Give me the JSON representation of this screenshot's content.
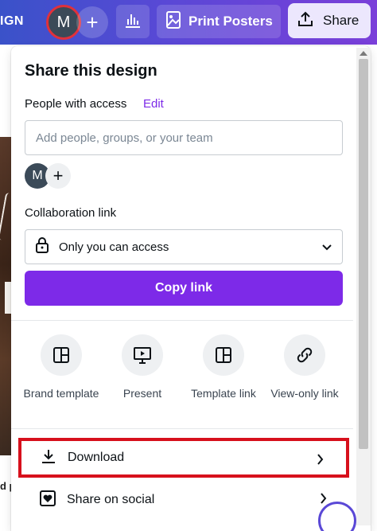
{
  "header": {
    "design_label": "IGN",
    "avatar_initial": "M",
    "add_collab_symbol": "+",
    "print_label": "Print Posters",
    "share_label": "Share"
  },
  "background": {
    "label": "d p"
  },
  "panel": {
    "title": "Share this design",
    "people_access_label": "People with access",
    "edit_label": "Edit",
    "people_input_placeholder": "Add people, groups, or your team",
    "member_initial": "M",
    "member_add_symbol": "+",
    "collab_label": "Collaboration link",
    "access_value": "Only you can access",
    "copy_label": "Copy link",
    "options": [
      {
        "label": "Brand template",
        "icon": "template-icon"
      },
      {
        "label": "Present",
        "icon": "present-icon"
      },
      {
        "label": "Template link",
        "icon": "template-link-icon"
      },
      {
        "label": "View-only link",
        "icon": "link-icon"
      }
    ],
    "rows": [
      {
        "label": "Download",
        "icon": "download-icon"
      },
      {
        "label": "Share on social",
        "icon": "heart-icon"
      }
    ]
  },
  "colors": {
    "accent": "#7d2ae8",
    "highlight": "#d7101c"
  }
}
